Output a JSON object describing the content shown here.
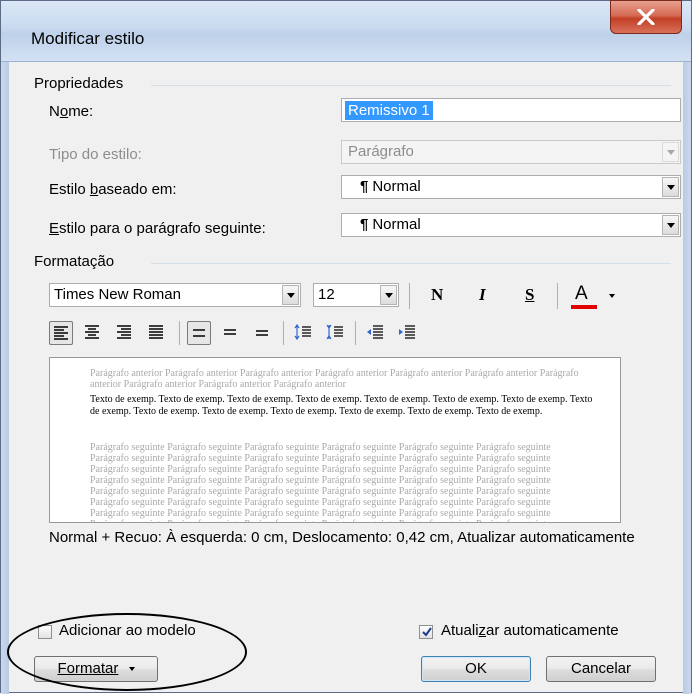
{
  "window": {
    "title": "Modificar estilo"
  },
  "properties": {
    "group_label": "Propriedades",
    "name_label": "Nome:",
    "name_value": "Remissivo 1",
    "type_label": "Tipo do estilo:",
    "type_value": "Parágrafo",
    "based_on_label": "Estilo baseado em:",
    "based_on_value": "Normal",
    "next_label": "Estilo para o parágrafo seguinte:",
    "next_value": "Normal",
    "paragraph_mark": "¶"
  },
  "formatting": {
    "group_label": "Formatação",
    "font": "Times New Roman",
    "size": "12",
    "bold": "N",
    "italic": "I",
    "underline": "S",
    "font_color_letter": "A",
    "font_color_hex": "#e00000"
  },
  "preview": {
    "prev_paragraph": "Parágrafo anterior Parágrafo anterior Parágrafo anterior Parágrafo anterior Parágrafo anterior Parágrafo anterior Parágrafo anterior Parágrafo anterior Parágrafo anterior Parágrafo anterior",
    "sample_text": "Texto de exemp. Texto de exemp. Texto de exemp. Texto de exemp. Texto de exemp. Texto de exemp. Texto de exemp. Texto de exemp. Texto de exemp. Texto de exemp. Texto de exemp. Texto de exemp. Texto de exemp. Texto de exemp.",
    "next_paragraph": "Parágrafo seguinte Parágrafo seguinte Parágrafo seguinte Parágrafo seguinte Parágrafo seguinte Parágrafo seguinte Parágrafo seguinte Parágrafo seguinte Parágrafo seguinte Parágrafo seguinte Parágrafo seguinte Parágrafo seguinte Parágrafo seguinte Parágrafo seguinte Parágrafo seguinte Parágrafo seguinte Parágrafo seguinte Parágrafo seguinte Parágrafo seguinte Parágrafo seguinte Parágrafo seguinte Parágrafo seguinte Parágrafo seguinte Parágrafo seguinte Parágrafo seguinte Parágrafo seguinte Parágrafo seguinte Parágrafo seguinte Parágrafo seguinte Parágrafo seguinte Parágrafo seguinte Parágrafo seguinte Parágrafo seguinte Parágrafo seguinte Parágrafo seguinte Parágrafo seguinte Parágrafo seguinte Parágrafo seguinte Parágrafo seguinte Parágrafo seguinte Parágrafo seguinte Parágrafo seguinte Parágrafo seguinte Parágrafo seguinte Parágrafo seguinte Parágrafo seguinte Parágrafo seguinte Parágrafo seguinte"
  },
  "description": "Normal + Recuo: À esquerda:  0 cm, Deslocamento:  0,42 cm, Atualizar automaticamente",
  "options": {
    "add_to_template_label": "Adicionar ao modelo",
    "add_to_template_checked": false,
    "auto_update_label": "Atualizar automaticamente",
    "auto_update_checked": true
  },
  "buttons": {
    "format": "Formatar",
    "ok": "OK",
    "cancel": "Cancelar"
  }
}
